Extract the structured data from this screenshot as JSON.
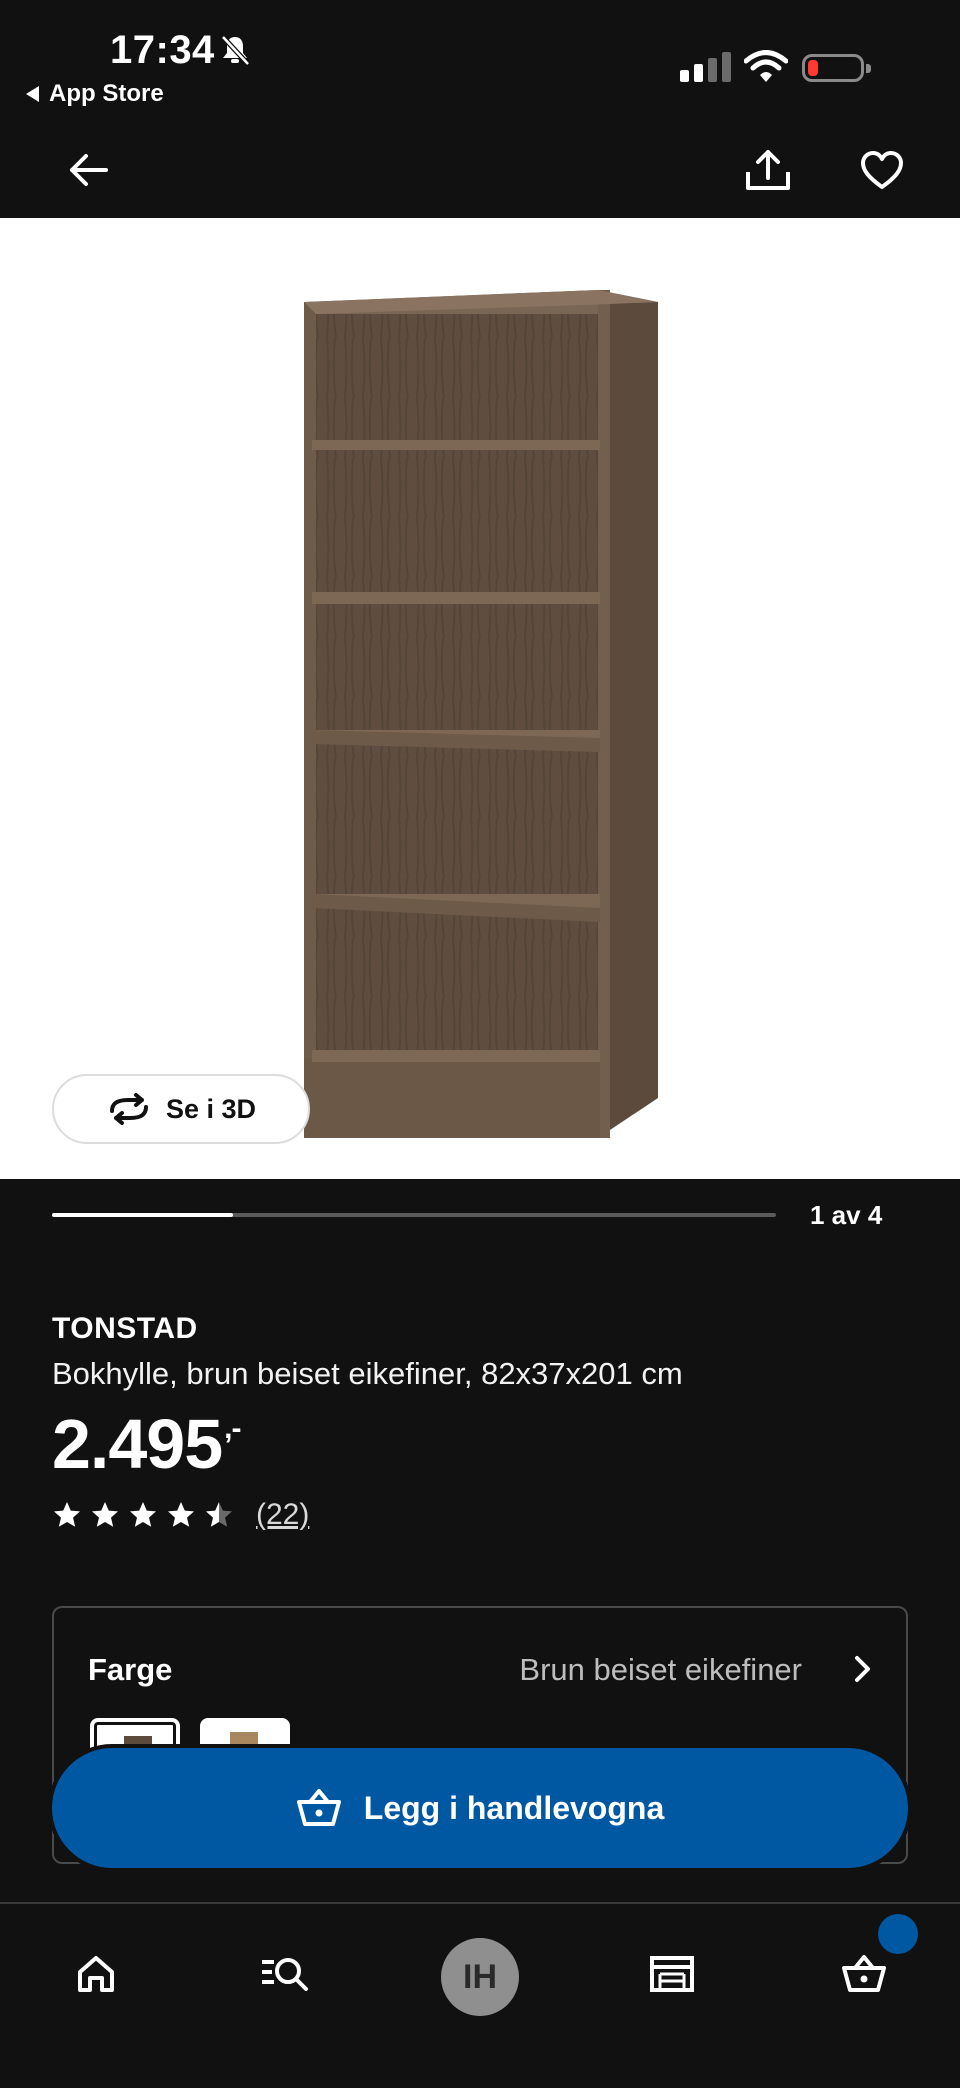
{
  "status_bar": {
    "time": "17:34",
    "back_app": "App Store",
    "icons": [
      "bell-slash-icon",
      "cellular-signal-icon",
      "wifi-icon",
      "battery-icon"
    ],
    "battery_level": 0.1,
    "battery_color": "#ff3b30"
  },
  "nav": {
    "icons": [
      "arrow-left-icon",
      "share-icon",
      "heart-icon"
    ]
  },
  "gallery": {
    "view_3d_label": "Se i 3D",
    "counter": "1 av 4",
    "progress": 0.25,
    "product_image": "bookshelf-image"
  },
  "product": {
    "brand": "TONSTAD",
    "description": "Bokhylle, brun beiset eikefiner, 82x37x201 cm",
    "price": "2.495",
    "price_suffix": ",-",
    "rating": 4.5,
    "rating_count": "(22)"
  },
  "color": {
    "label": "Farge",
    "value": "Brun beiset eikefiner",
    "swatches": [
      "brown-stained-oak",
      "oak"
    ],
    "selected": 0
  },
  "cart_button": {
    "label": "Legg i handlevogna"
  },
  "bottom_nav": {
    "items": [
      "home-icon",
      "search-icon",
      "profile-avatar",
      "store-icon",
      "cart-icon"
    ],
    "avatar_initials": "IH"
  },
  "colors": {
    "background": "#111111",
    "accent_blue": "#0058a3",
    "wood": "#6b5846"
  }
}
